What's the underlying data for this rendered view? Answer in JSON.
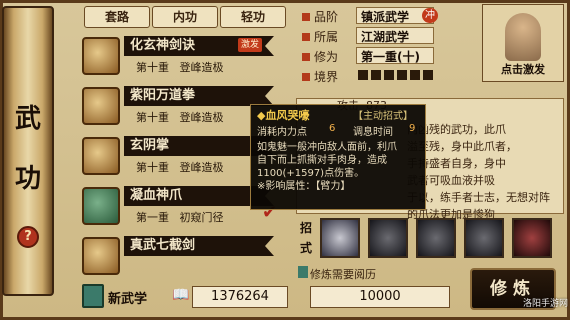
{
  "left_scroll": {
    "char1": "武",
    "char2": "功",
    "help": "?"
  },
  "tabs": [
    "套路",
    "内功",
    "轻功"
  ],
  "skills": [
    {
      "name": "化玄神剑诀",
      "level": "第十重",
      "status": "登峰造极",
      "badge": "激发"
    },
    {
      "name": "紫阳万道拳",
      "level": "第十重",
      "status": "登峰造极"
    },
    {
      "name": "玄阴掌",
      "level": "第十重",
      "status": "登峰造极"
    },
    {
      "name": "凝血神爪",
      "level": "第一重",
      "status": "初窥门径",
      "checked": true
    },
    {
      "name": "真武七截剑",
      "level": "",
      "status": ""
    }
  ],
  "new_skill": {
    "label": "新武学",
    "value": "1376264"
  },
  "info": {
    "rows": [
      {
        "key": "品阶",
        "value": "镇派武学",
        "tag": "冲"
      },
      {
        "key": "所属",
        "value": "江湖武学"
      },
      {
        "key": "修为",
        "value": "第一重(十)"
      },
      {
        "key": "境界",
        "value": ""
      }
    ],
    "attack_label": "攻击",
    "attack_value": "873"
  },
  "portrait": {
    "caption": "点击激发"
  },
  "tooltip": {
    "title": "◆血风哭嚎",
    "mode": "【主动招式】",
    "cost_label": "消耗内力点",
    "cost_value": "6",
    "cd_label": "调息时间",
    "cd_value": "9",
    "body": "如鬼魅一般冲向敌人面前，利爪\n自下而上抓撕对手肉身，造成\n1100(+1597)点伤害。\n※影响属性：【臂力】"
  },
  "desc_bg": "内凶残的武功，此爪\n溢至残，身中此爪者，\n手持盛者自身，身中\n武者可吸血液并吸\n于以，练手者士志，无想对阵\n的爪法更加是惨狗",
  "moves": {
    "label": "招式",
    "count": 5
  },
  "requirement": {
    "label": "修炼需要阅历",
    "value": "10000"
  },
  "practice_button": "修炼",
  "watermark": "洛阳手游网"
}
